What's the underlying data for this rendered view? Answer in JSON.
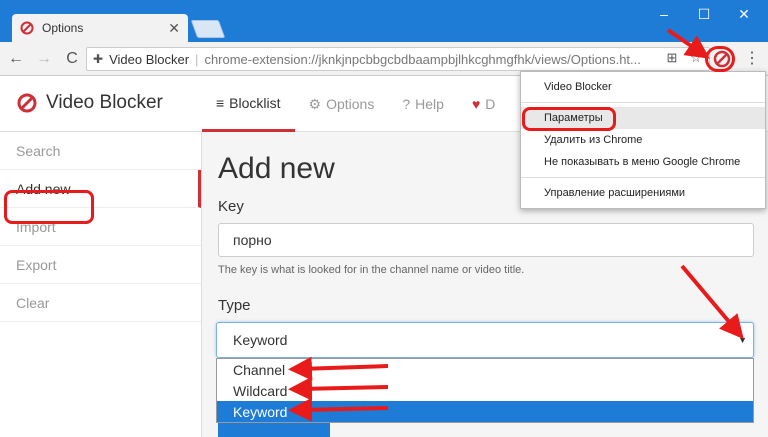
{
  "window": {
    "tab_title": "Options",
    "tab_close": "✕",
    "min": "–",
    "max": "☐",
    "close": "✕"
  },
  "toolbar": {
    "back": "←",
    "forward": "→",
    "reload": "C",
    "extension_name": "Video Blocker",
    "separator": "|",
    "url": "chrome-extension://jknkjnpcbbgcbdbaampbjlhkcghmgfhk/views/Options.ht...",
    "translate_icon": "⊞",
    "star_icon": "☆",
    "menu_icon": "⋮"
  },
  "app": {
    "brand": "Video Blocker",
    "nav": [
      {
        "icon": "≡",
        "label": "Blocklist"
      },
      {
        "icon": "⚙",
        "label": "Options"
      },
      {
        "icon": "?",
        "label": "Help"
      },
      {
        "icon": "♥",
        "label": "D"
      }
    ],
    "sidebar": [
      "Search",
      "Add new",
      "Import",
      "Export",
      "Clear"
    ],
    "heading": "Add new",
    "key_label": "Key",
    "key_value": "порно",
    "key_help": "The key is what is looked for in the channel name or video title.",
    "type_label": "Type",
    "type_selected": "Keyword",
    "type_options": [
      "Channel",
      "Wildcard",
      "Keyword"
    ]
  },
  "context_menu": {
    "items": [
      "Video Blocker",
      "Параметры",
      "Удалить из Chrome",
      "Не показывать в меню Google Chrome",
      "Управление расширениями"
    ]
  },
  "colors": {
    "chrome_blue": "#1e7bd6",
    "brand_red": "#cf2f37",
    "annotation_red": "#e81a1a"
  }
}
